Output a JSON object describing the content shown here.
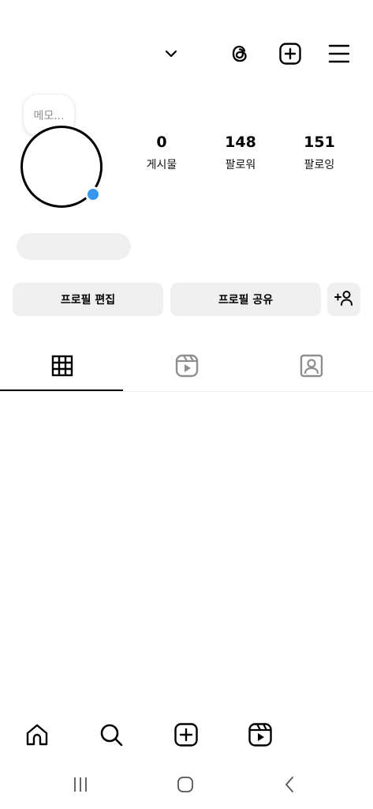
{
  "header": {
    "icons": [
      "chevron-down-icon",
      "threads-icon",
      "create-icon",
      "menu-icon"
    ]
  },
  "note": {
    "placeholder": "메모..."
  },
  "stats": {
    "posts": {
      "count": "0",
      "label": "게시물"
    },
    "followers": {
      "count": "148",
      "label": "팔로워"
    },
    "following": {
      "count": "151",
      "label": "팔로잉"
    }
  },
  "actions": {
    "edit_profile": "프로필 편집",
    "share_profile": "프로필 공유",
    "add_friend_icon": "person-plus-icon"
  },
  "tabs": {
    "items": [
      "grid-icon",
      "reels-icon",
      "tagged-icon"
    ],
    "active": "grid-icon"
  },
  "bottom_nav": [
    "home-icon",
    "search-icon",
    "create-icon",
    "reels-icon"
  ],
  "system_nav": [
    "recents-icon",
    "home-button-icon",
    "back-icon"
  ],
  "colors": {
    "accent_badge": "#3797f0",
    "button_bg": "#efefef",
    "muted_text": "#8e8e8e"
  }
}
